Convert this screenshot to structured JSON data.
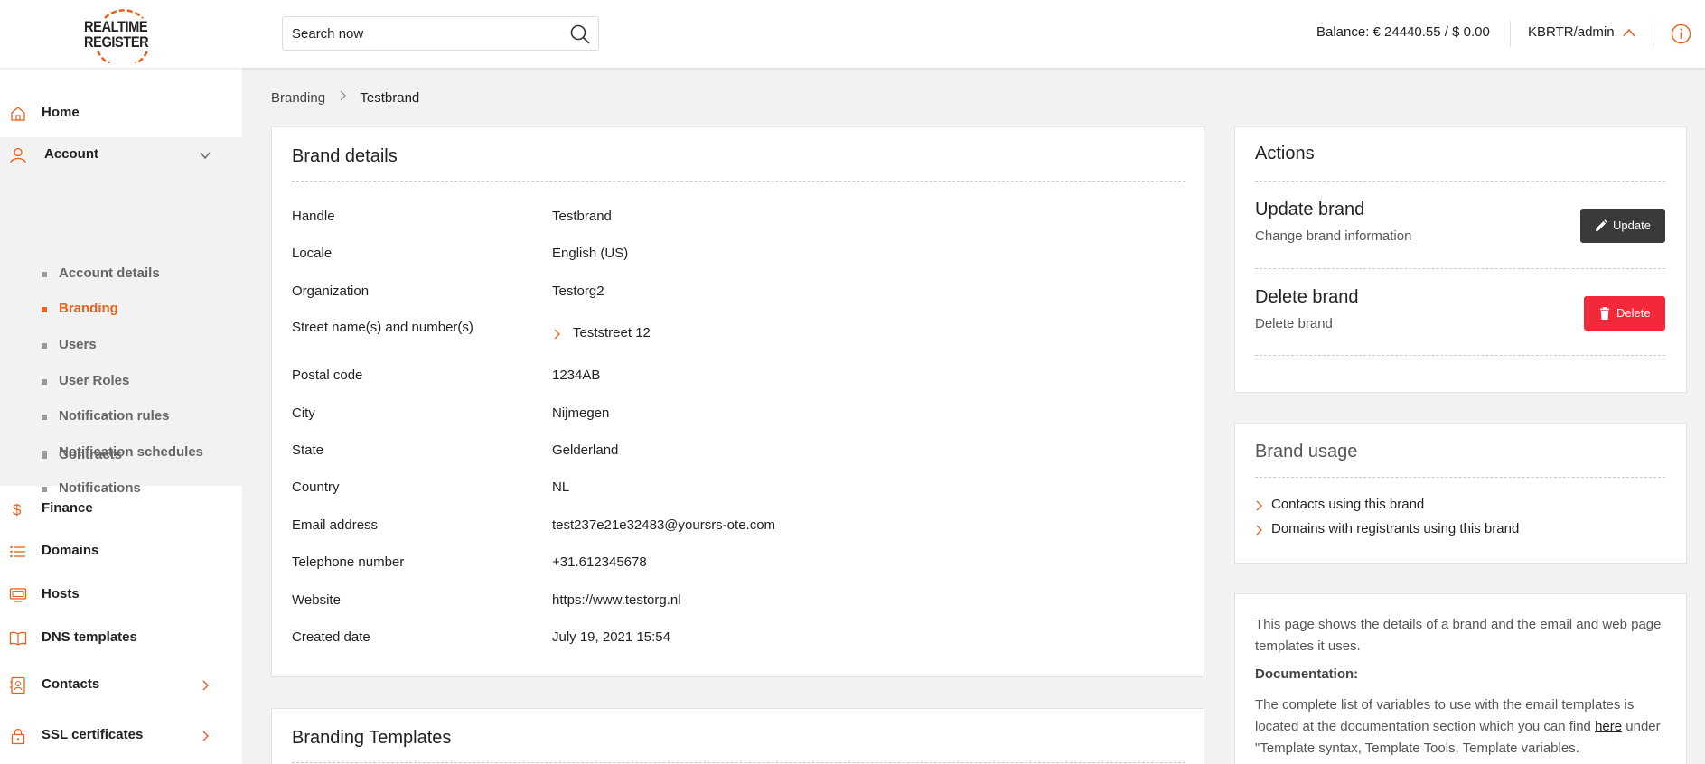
{
  "header": {
    "logo_line1": "REALTIME",
    "logo_line2": "REGISTER",
    "search_placeholder": "Search now",
    "balance": "Balance: € 24440.55 / $ 0.00",
    "user": "KBRTR/admin",
    "accent_color": "#e8601c"
  },
  "sidebar": {
    "items": [
      {
        "label": "Home",
        "icon": "home-icon"
      },
      {
        "label": "Account",
        "icon": "user-icon"
      },
      {
        "label": "Finance",
        "icon": "dollar-icon"
      },
      {
        "label": "Domains",
        "icon": "list-icon"
      },
      {
        "label": "Hosts",
        "icon": "monitor-icon"
      },
      {
        "label": "DNS templates",
        "icon": "book-icon"
      },
      {
        "label": "Contacts",
        "icon": "contacts-icon"
      },
      {
        "label": "SSL certificates",
        "icon": "lock-icon"
      }
    ],
    "account_sub": [
      "Account details",
      "Branding",
      "Users",
      "User Roles",
      "Notification rules",
      "Notification schedules",
      "Notifications",
      "Contracts"
    ],
    "active_sub": "Branding"
  },
  "breadcrumb": {
    "parent": "Branding",
    "current": "Testbrand"
  },
  "details": {
    "title": "Brand details",
    "rows": [
      {
        "key": "Handle",
        "value": "Testbrand"
      },
      {
        "key": "Locale",
        "value": "English (US)"
      },
      {
        "key": "Organization",
        "value": "Testorg2"
      },
      {
        "key": "Street name(s) and number(s)",
        "value": "Teststreet 12"
      },
      {
        "key": "Postal code",
        "value": "1234AB"
      },
      {
        "key": "City",
        "value": "Nijmegen"
      },
      {
        "key": "State",
        "value": "Gelderland"
      },
      {
        "key": "Country",
        "value": "NL"
      },
      {
        "key": "Email address",
        "value": "test237e21e32483@yoursrs-ote.com"
      },
      {
        "key": "Telephone number",
        "value": "+31.612345678"
      },
      {
        "key": "Website",
        "value": "https://www.testorg.nl"
      },
      {
        "key": "Created date",
        "value": "July 19, 2021 15:54"
      }
    ]
  },
  "templates": {
    "title": "Branding Templates"
  },
  "actions": {
    "title": "Actions",
    "update_title": "Update brand",
    "update_sub": "Change brand information",
    "update_btn": "Update",
    "delete_title": "Delete brand",
    "delete_sub": "Delete brand",
    "delete_btn": "Delete",
    "update_color": "#3a3a3a",
    "delete_color": "#f2283b"
  },
  "usage": {
    "title": "Brand usage",
    "links": [
      "Contacts using this brand",
      "Domains with registrants using this brand"
    ]
  },
  "info": {
    "intro": "This page shows the details of a brand and the email and web page templates it uses.",
    "doc_heading": "Documentation:",
    "doc_text_before": "The complete list of variables to use with the email templates is located at the documentation section which you can find ",
    "doc_link": "here",
    "doc_text_after": " under \"Template syntax, Template Tools, Template variables."
  }
}
